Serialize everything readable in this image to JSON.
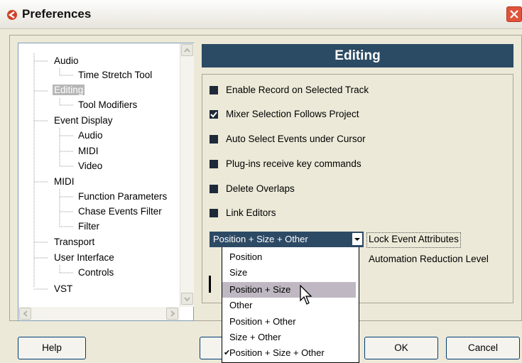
{
  "window": {
    "title": "Preferences",
    "icon": "cubase-logo-icon",
    "close_icon": "close-icon"
  },
  "tree": {
    "items": [
      {
        "label": "Audio",
        "level": 0
      },
      {
        "label": "Time Stretch Tool",
        "level": 1
      },
      {
        "label": "Editing",
        "level": 0,
        "selected": true
      },
      {
        "label": "Tool Modifiers",
        "level": 1
      },
      {
        "label": "Event Display",
        "level": 0
      },
      {
        "label": "Audio",
        "level": 1
      },
      {
        "label": "MIDI",
        "level": 1
      },
      {
        "label": "Video",
        "level": 1
      },
      {
        "label": "MIDI",
        "level": 0
      },
      {
        "label": "Function Parameters",
        "level": 1
      },
      {
        "label": "Chase Events Filter",
        "level": 1
      },
      {
        "label": "Filter",
        "level": 1
      },
      {
        "label": "Transport",
        "level": 0
      },
      {
        "label": "User Interface",
        "level": 0
      },
      {
        "label": "Controls",
        "level": 1
      },
      {
        "label": "VST",
        "level": 0
      }
    ]
  },
  "panel": {
    "heading": "Editing",
    "options": [
      {
        "label": "Enable Record on Selected Track",
        "checked": false
      },
      {
        "label": "Mixer Selection Follows Project",
        "checked": true
      },
      {
        "label": "Auto Select Events under Cursor",
        "checked": false
      },
      {
        "label": "Plug-ins receive key commands",
        "checked": false
      },
      {
        "label": "Delete Overlaps",
        "checked": false
      },
      {
        "label": "Link Editors",
        "checked": false
      }
    ],
    "lock_event_attributes": {
      "value": "Position + Size + Other",
      "label": "Lock Event Attributes",
      "options": [
        {
          "label": "Position",
          "checked": false
        },
        {
          "label": "Size",
          "checked": false
        },
        {
          "label": "Position + Size",
          "checked": false,
          "highlighted": true
        },
        {
          "label": "Other",
          "checked": false
        },
        {
          "label": "Position + Other",
          "checked": false
        },
        {
          "label": "Size + Other",
          "checked": false
        },
        {
          "label": "Position + Size + Other",
          "checked": true
        }
      ]
    },
    "automation_reduction_label": "Automation Reduction Level"
  },
  "buttons": {
    "help": "Help",
    "ok": "OK",
    "cancel": "Cancel"
  },
  "colors": {
    "heading_bg": "#2b4a63",
    "close_red": "#e0533b",
    "highlight": "#bfb8c3"
  }
}
